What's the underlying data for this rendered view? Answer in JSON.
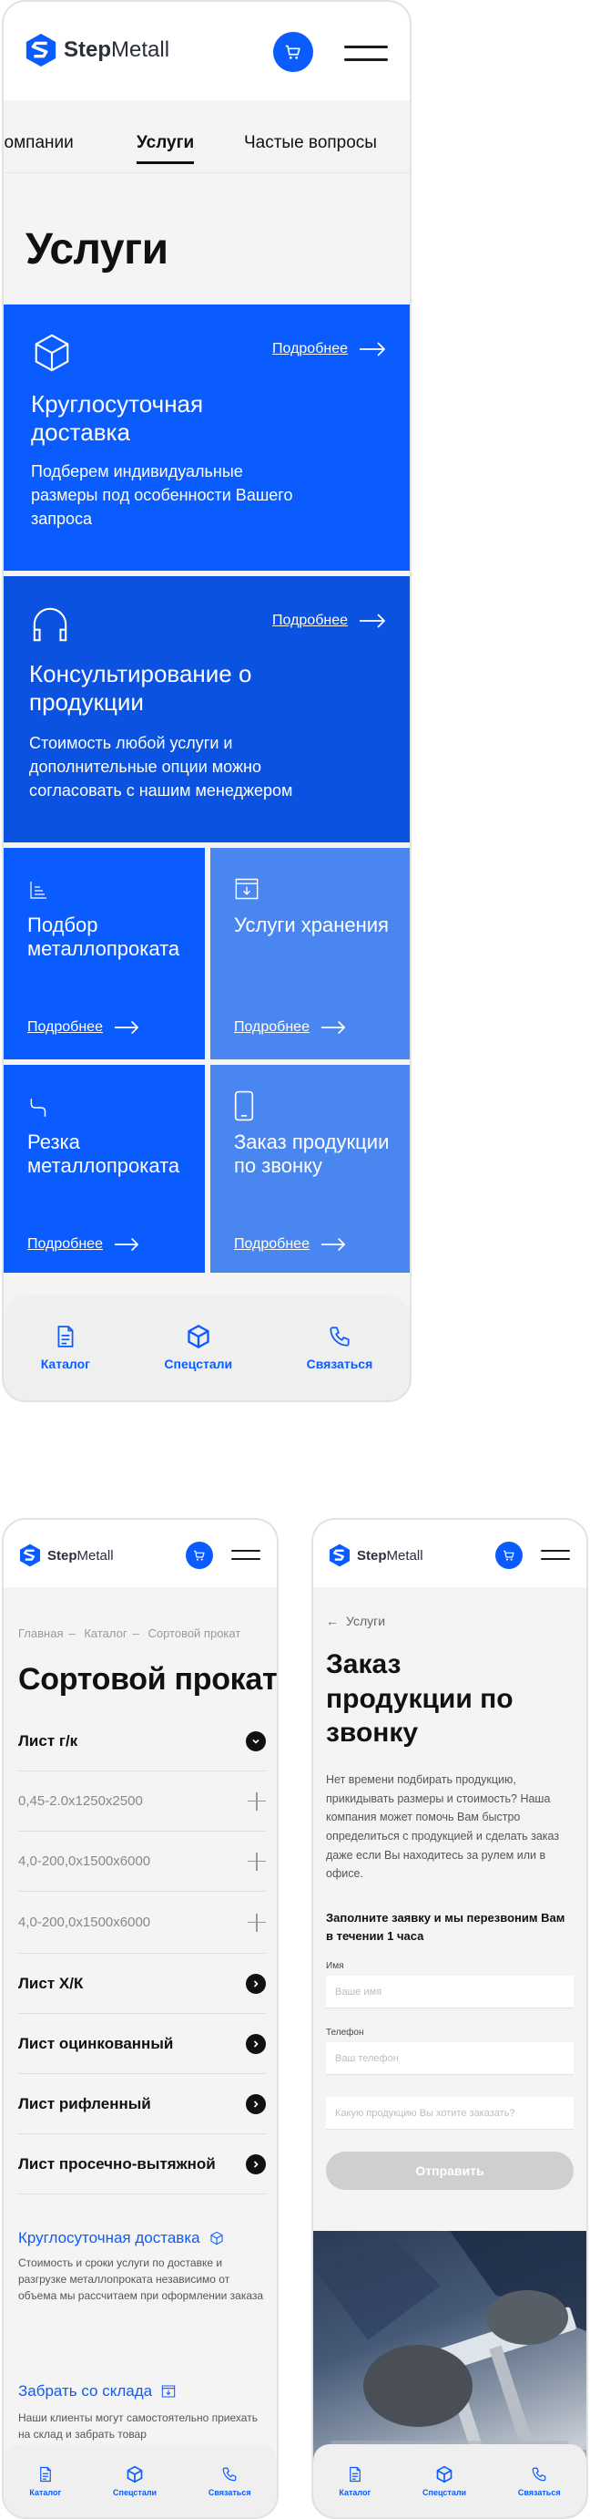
{
  "brand": {
    "name_bold": "Step",
    "name_regular": "Metall",
    "accent": "#0a5cff"
  },
  "nav": {
    "catalog_label": "Каталог",
    "specials_label": "Спецстали",
    "contact_label": "Связаться"
  },
  "main_screen": {
    "tabs": [
      {
        "label": "компании"
      },
      {
        "label": "Услуги"
      },
      {
        "label": "Частые вопросы"
      }
    ],
    "page_title": "Услуги",
    "more_label": "Подробнее",
    "cards": [
      {
        "title": "Круглосуточная доставка",
        "desc": "Подберем индивидуальные размеры под особенности Вашего запроса",
        "color": "#0a5cff"
      },
      {
        "title": "Консультирование о продукции",
        "desc": "Стоимость любой услуги и дополнительные опции можно согласовать с нашим менеджером",
        "color": "#0b52e0"
      },
      {
        "title": "Подбор металлопроката",
        "color": "#0a5cff"
      },
      {
        "title": "Услуги хранения",
        "color": "#4a86f0"
      },
      {
        "title": "Резка металлопроката",
        "color": "#0a5cff"
      },
      {
        "title": "Заказ продукции по звонку",
        "color": "#4a86f0"
      }
    ]
  },
  "catalog_screen": {
    "breadcrumbs": [
      "Главная",
      "Каталог",
      "Сортовой прокат"
    ],
    "page_title": "Сортовой прокат",
    "groups": [
      {
        "label": "Лист г/к"
      },
      {
        "label": "Лист  Х/К"
      },
      {
        "label": "Лист оцинкованный"
      },
      {
        "label": "Лист рифленный"
      },
      {
        "label": "Лист просечно-вытяжной"
      }
    ],
    "sub_items": [
      "0,45-2.0х1250х2500",
      "4,0-200,0х1500х6000",
      "4,0-200,0х1500х6000"
    ],
    "features": [
      {
        "title": "Круглосуточная доставка",
        "desc": "Стоимость и сроки услуги по доставке и разгрузке металлопроката независимо от объема мы рассчитаем при оформлении заказа"
      },
      {
        "title": "Забрать со склада",
        "desc": "Наши клиенты могут самостоятельно приехать на склад и забрать товар"
      }
    ]
  },
  "order_screen": {
    "back_label": "Услуги",
    "title": "Заказ продукции по звонку",
    "description": "Нет времени подбирать продукцию, прикидывать размеры и стоимость? Наша компания может помочь Вам быстро определиться с продукцией и сделать заказ даже если Вы находитесь за рулем или в офисе.",
    "form_heading": "Заполните заявку и мы перезвоним Вам в течении 1 часа",
    "name_label": "Имя",
    "name_placeholder": "Ваше имя",
    "phone_label": "Телефон",
    "phone_placeholder": "Ваш телефон",
    "product_placeholder": "Какую продукцию Вы хотите заказать?",
    "submit_label": "Отправить"
  }
}
